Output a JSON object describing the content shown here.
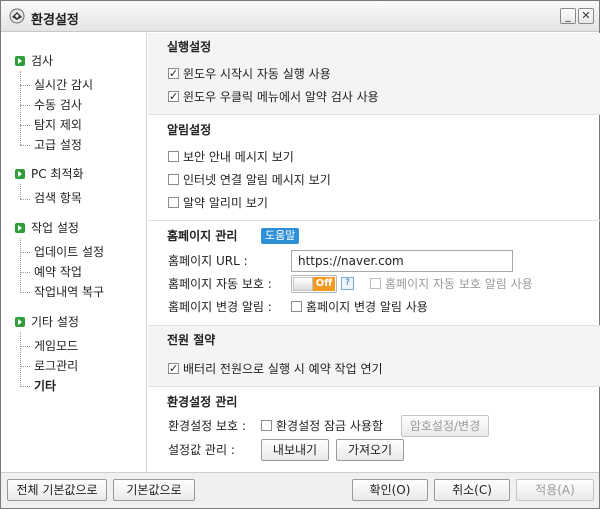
{
  "window": {
    "title": "환경설정",
    "minimize": "_",
    "close": "✕"
  },
  "sidebar": {
    "sections": [
      {
        "label": "검사",
        "items": [
          "실시간 감시",
          "수동 검사",
          "탐지 제외",
          "고급 설정"
        ]
      },
      {
        "label": "PC 최적화",
        "items": [
          "검색 항목"
        ]
      },
      {
        "label": "작업 설정",
        "items": [
          "업데이트 설정",
          "예약 작업",
          "작업내역 복구"
        ]
      },
      {
        "label": "기타 설정",
        "items": [
          "게임모드",
          "로그관리",
          "기타"
        ]
      }
    ],
    "active_item": "기타"
  },
  "execution": {
    "title": "실행설정",
    "opt1": "윈도우 시작시 자동 실행 사용",
    "opt2": "윈도우 우클릭 메뉴에서 알약 검사 사용",
    "opt1_checked": true,
    "opt2_checked": true
  },
  "notification": {
    "title": "알림설정",
    "opt1": "보안 안내 메시지 보기",
    "opt2": "인터넷 연결 알림 메시지 보기",
    "opt3": "알약 알리미 보기"
  },
  "homepage": {
    "title": "홈페이지 관리",
    "help": "도움말",
    "url_label": "홈페이지 URL :",
    "url_value": "https://naver.com",
    "protect_label": "홈페이지 자동 보호 :",
    "toggle_state": "Off",
    "help_q": "?",
    "protect_alert": "홈페이지 자동 보호 알림 사용",
    "change_label": "홈페이지 변경 알림 :",
    "change_alert": "홈페이지 변경 알림 사용"
  },
  "power": {
    "title": "전원 절약",
    "opt1": "배터리 전원으로 실행 시 예약 작업 연기",
    "opt1_checked": true
  },
  "config": {
    "title": "환경설정 관리",
    "protect_label": "환경설정 보호 :",
    "lock_opt": "환경설정 잠금 사용함",
    "password_btn": "암호설정/변경",
    "manage_label": "설정값 관리 :",
    "export_btn": "내보내기",
    "import_btn": "가져오기"
  },
  "footer": {
    "reset_all": "전체 기본값으로",
    "reset": "기본값으로",
    "ok": "확인(O)",
    "cancel": "취소(C)",
    "apply": "적용(A)"
  }
}
